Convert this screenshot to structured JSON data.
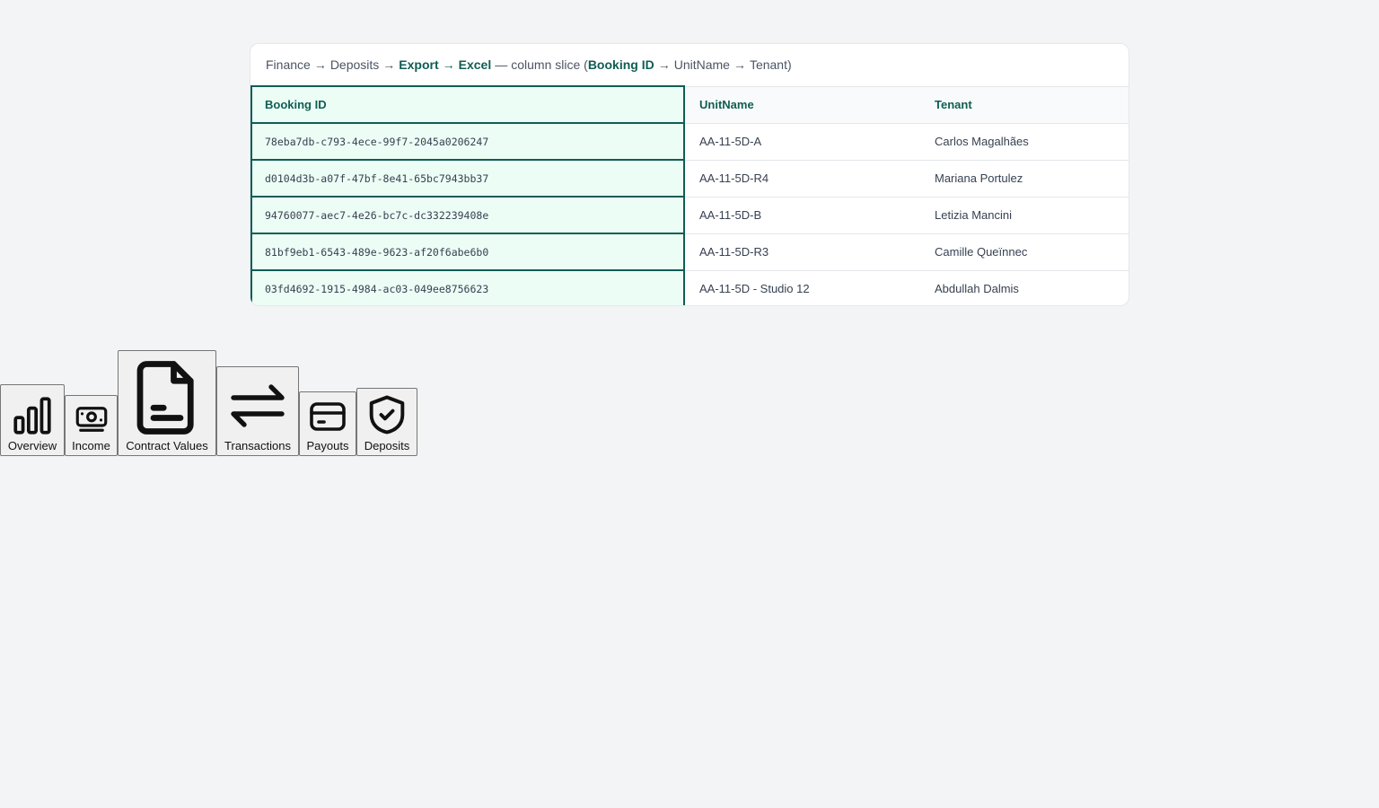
{
  "breadcrumb": {
    "finance": "Finance",
    "arrow": "→",
    "deposits": "Deposits",
    "export": "Export",
    "excel": "Excel",
    "dash": "—",
    "slice_prefix": "column slice (",
    "booking_id": "Booking ID",
    "unitname": "UnitName",
    "tenant": "Tenant)"
  },
  "table": {
    "headers": [
      "Booking ID",
      "UnitName",
      "Tenant"
    ],
    "rows": [
      [
        "78eba7db-c793-4ece-99f7-2045a0206247",
        "AA-11-5D-A",
        "Carlos Magalhães"
      ],
      [
        "d0104d3b-a07f-47bf-8e41-65bc7943bb37",
        "AA-11-5D-R4",
        "Mariana Portulez"
      ],
      [
        "94760077-aec7-4e26-bc7c-dc332239408e",
        "AA-11-5D-B",
        "Letizia Mancini"
      ],
      [
        "81bf9eb1-6543-489e-9623-af20f6abe6b0",
        "AA-11-5D-R3",
        "Camille Queïnnec"
      ],
      [
        "03fd4692-1915-4984-ac03-049ee8756623",
        "AA-11-5D - Studio 12",
        "Abdullah Dalmis"
      ]
    ]
  },
  "nav": {
    "items": [
      {
        "label": "Overview",
        "icon": "bar-chart-icon"
      },
      {
        "label": "Income",
        "icon": "money-icon"
      },
      {
        "label": "Contract Values",
        "icon": "file-icon"
      },
      {
        "label": "Transactions",
        "icon": "arrows-exchange-icon"
      },
      {
        "label": "Payouts",
        "icon": "credit-card-icon"
      },
      {
        "label": "Deposits",
        "icon": "shield-check-icon"
      }
    ]
  },
  "colors": {
    "accent": "#0f5e54",
    "highlight_bg": "#ecfdf5"
  }
}
